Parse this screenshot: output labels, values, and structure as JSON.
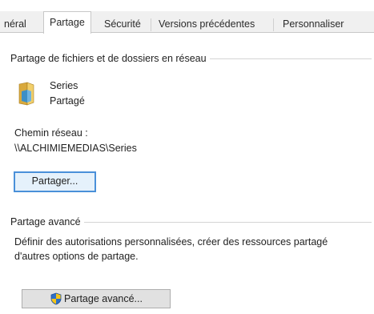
{
  "tabs": [
    {
      "label": "néral",
      "name": "tab-general"
    },
    {
      "label": "Partage",
      "name": "tab-partage"
    },
    {
      "label": "Sécurité",
      "name": "tab-securite"
    },
    {
      "label": "Versions précédentes",
      "name": "tab-versions"
    },
    {
      "label": "Personnaliser",
      "name": "tab-personnaliser"
    }
  ],
  "network_share": {
    "group_title": "Partage de fichiers et de dossiers en réseau",
    "folder_name": "Series",
    "folder_status": "Partagé",
    "path_label": "Chemin réseau :",
    "path_value": "\\\\ALCHIMIEMEDIAS\\Series",
    "share_button": "Partager..."
  },
  "advanced_share": {
    "group_title": "Partage avancé",
    "description_line1": "Définir des autorisations personnalisées, créer des ressources partagé",
    "description_line2": "d'autres options de partage.",
    "button": "Partage avancé..."
  },
  "colors": {
    "tab_bg": "#f0f0f0",
    "focus_border": "#4a90d9",
    "button_bg": "#e1e1e1"
  }
}
